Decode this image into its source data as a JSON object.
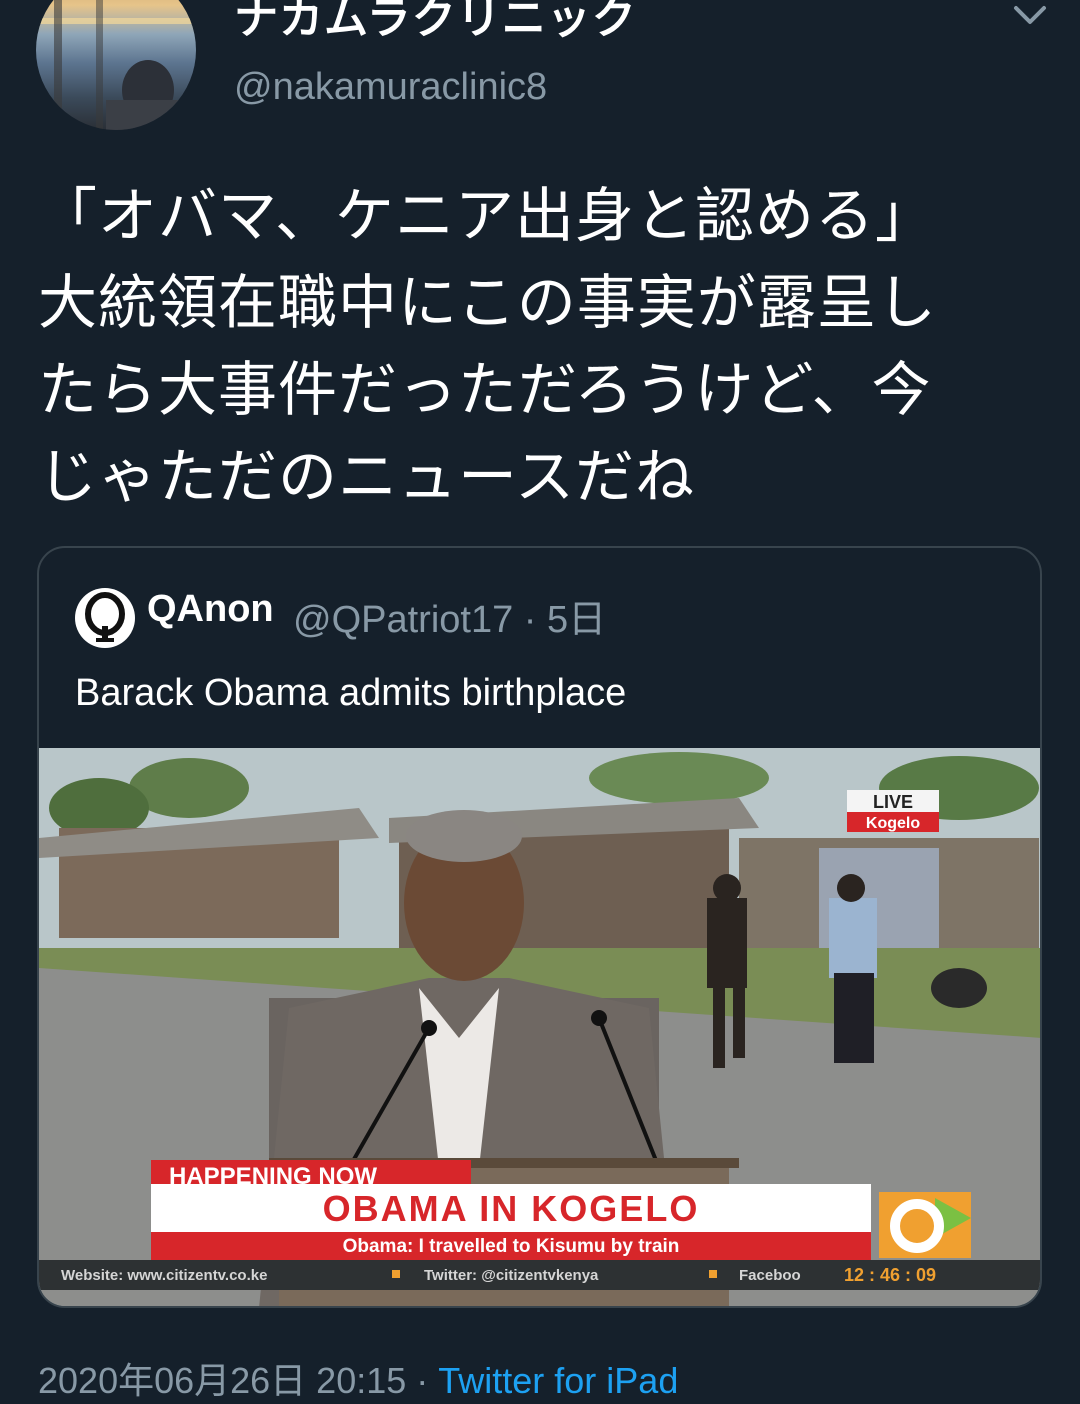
{
  "author": {
    "display_name": "ナカムラクリニック",
    "handle": "@nakamuraclinic8"
  },
  "tweet": {
    "text": "「オバマ、ケニア出身と認める」\n大統領在職中にこの事実が露呈し\nたら大事件だっただろうけど、今\nじゃただのニュースだね"
  },
  "quoted_tweet": {
    "author_name": "QAnon",
    "author_handle": "@QPatriot17",
    "separator": "·",
    "time_ago": "5日",
    "text": "Barack Obama admits birthplace",
    "media": {
      "live_label": "LIVE",
      "live_location": "Kogelo",
      "kicker": "HAPPENING NOW",
      "headline": "OBAMA IN KOGELO",
      "subhead": "Obama: I travelled to Kisumu by train",
      "ticker_website": "Website: www.citizentv.co.ke",
      "ticker_twitter": "Twitter: @citizentvkenya",
      "ticker_facebook": "Faceboo",
      "clock": "12 : 46 : 09"
    }
  },
  "footer": {
    "timestamp": "2020年06月26日 20:15",
    "separator": " · ",
    "source": "Twitter for iPad"
  },
  "colors": {
    "background": "#15202b",
    "secondary_text": "#8899a6",
    "link": "#1da1f2",
    "border": "#38444d",
    "banner_red": "#d7262a"
  }
}
